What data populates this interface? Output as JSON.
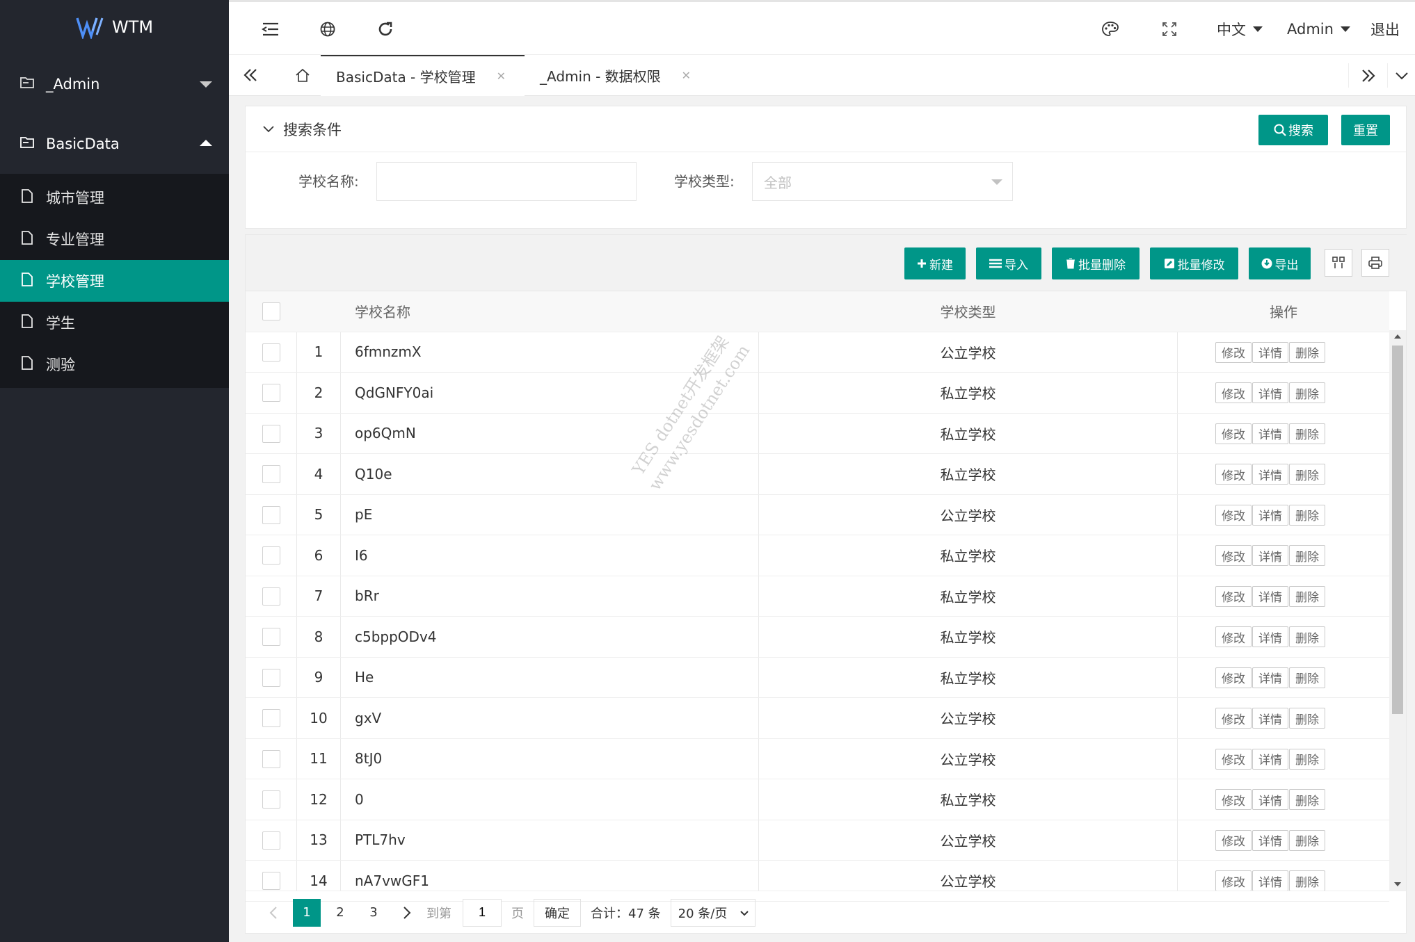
{
  "app": {
    "logo_text": "WTM"
  },
  "sidebar": {
    "groups": [
      {
        "label": "_Admin",
        "expanded": false
      },
      {
        "label": "BasicData",
        "expanded": true
      }
    ],
    "items": [
      {
        "label": "城市管理"
      },
      {
        "label": "专业管理"
      },
      {
        "label": "学校管理",
        "active": true
      },
      {
        "label": "学生"
      },
      {
        "label": "测验"
      }
    ]
  },
  "header": {
    "language": "中文",
    "user": "Admin",
    "logout": "退出"
  },
  "tabs": [
    {
      "label": "BasicData - 学校管理",
      "active": true
    },
    {
      "label": "_Admin - 数据权限",
      "active": false
    }
  ],
  "search": {
    "title": "搜索条件",
    "search_button": "搜索",
    "reset_button": "重置",
    "school_name_label": "学校名称:",
    "school_name_value": "",
    "school_type_label": "学校类型:",
    "school_type_placeholder": "全部"
  },
  "toolbar": {
    "new": "新建",
    "import": "导入",
    "batch_delete": "批量删除",
    "batch_edit": "批量修改",
    "export": "导出"
  },
  "table": {
    "columns": [
      "学校名称",
      "学校类型",
      "操作"
    ],
    "actions": {
      "edit": "修改",
      "detail": "详情",
      "delete": "删除"
    },
    "rows": [
      {
        "no": "1",
        "name": "6fmnzmX",
        "type": "公立学校"
      },
      {
        "no": "2",
        "name": "QdGNFY0ai",
        "type": "私立学校"
      },
      {
        "no": "3",
        "name": "op6QmN",
        "type": "私立学校"
      },
      {
        "no": "4",
        "name": "Q10e",
        "type": "私立学校"
      },
      {
        "no": "5",
        "name": "pE",
        "type": "公立学校"
      },
      {
        "no": "6",
        "name": "I6",
        "type": "私立学校"
      },
      {
        "no": "7",
        "name": "bRr",
        "type": "私立学校"
      },
      {
        "no": "8",
        "name": "c5bppODv4",
        "type": "私立学校"
      },
      {
        "no": "9",
        "name": "He",
        "type": "私立学校"
      },
      {
        "no": "10",
        "name": "gxV",
        "type": "公立学校"
      },
      {
        "no": "11",
        "name": "8tJ0",
        "type": "公立学校"
      },
      {
        "no": "12",
        "name": "0",
        "type": "私立学校"
      },
      {
        "no": "13",
        "name": "PTL7hv",
        "type": "公立学校"
      },
      {
        "no": "14",
        "name": "nA7vwGF1",
        "type": "公立学校"
      }
    ]
  },
  "pager": {
    "pages": [
      "1",
      "2",
      "3"
    ],
    "current": "1",
    "goto_label": "到第",
    "goto_value": "1",
    "page_unit": "页",
    "confirm": "确定",
    "total": "合计：47 条",
    "page_size": "20 条/页"
  },
  "watermark": {
    "line1": "YES dotnet开发框架",
    "line2": "www.yesdotnet.com"
  },
  "colors": {
    "primary": "#009688",
    "sidebar_bg": "#23262e",
    "submenu_bg": "#16181d"
  }
}
